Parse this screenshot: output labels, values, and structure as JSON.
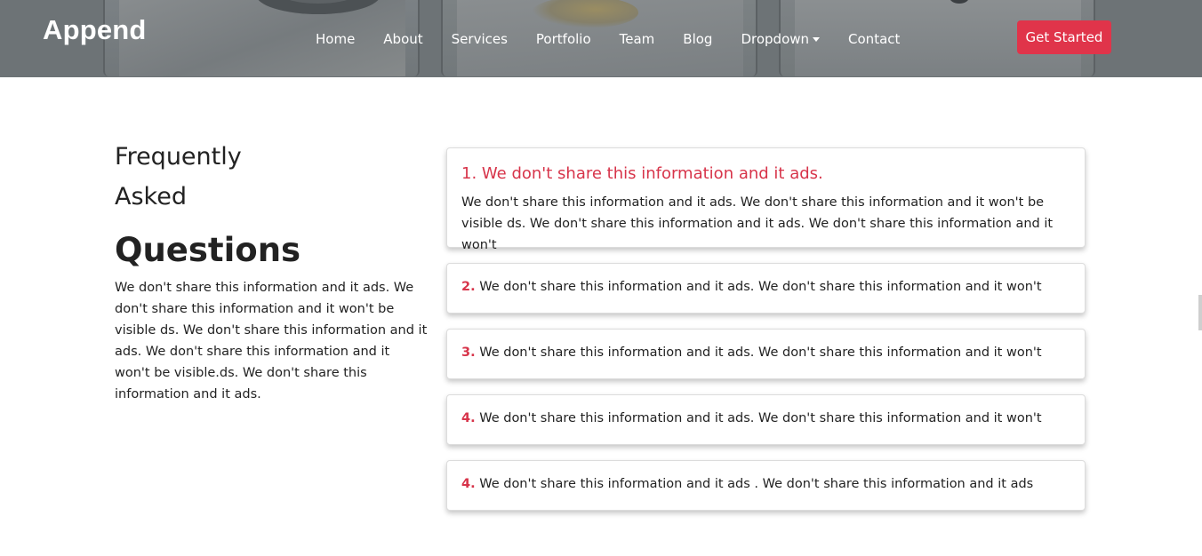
{
  "header": {
    "brand": "Append",
    "nav": [
      {
        "label": "Home"
      },
      {
        "label": "About"
      },
      {
        "label": "Services"
      },
      {
        "label": "Portfolio"
      },
      {
        "label": "Team"
      },
      {
        "label": "Blog"
      },
      {
        "label": "Dropdown"
      },
      {
        "label": "Contact"
      }
    ],
    "cta_label": "Get Started",
    "accent_color": "#e0344a"
  },
  "faq": {
    "title_line1": "Frequently",
    "title_line2": "Asked",
    "title_bold": "Questions",
    "description": "We don't share this information and it ads. We don't share this information and it won't be visible ds. We don't share this information and it ads. We don't share this information and it won't be visible.ds. We don't share this information and it ads.",
    "items": [
      {
        "number": "1.",
        "question": "We don't share this information and it ads.",
        "answer": "We don't share this information and it ads. We don't share this information and it won't be visible ds. We don't share this information and it ads. We don't share this information and it won't",
        "expanded": true
      },
      {
        "number": "2.",
        "question": "We don't share this information and it ads. We don't share this information and it won't",
        "expanded": false
      },
      {
        "number": "3.",
        "question": "We don't share this information and it ads. We don't share this information and it won't",
        "expanded": false
      },
      {
        "number": "4.",
        "question": "We don't share this information and it ads. We don't share this information and it won't",
        "expanded": false
      },
      {
        "number": "4.",
        "question": "We don't share this information and it ads . We don't share this information and it ads",
        "expanded": false
      }
    ]
  }
}
